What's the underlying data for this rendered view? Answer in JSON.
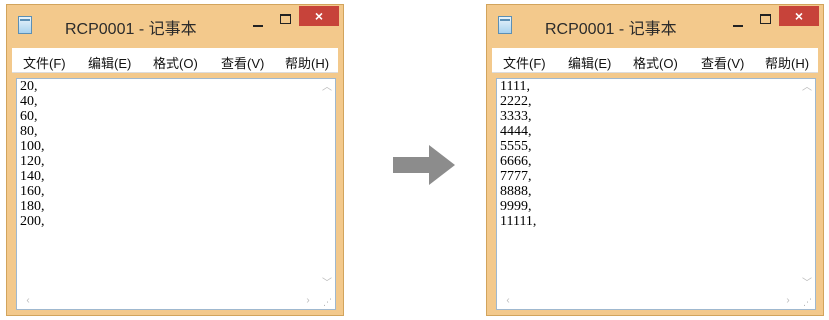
{
  "left_window": {
    "title": "RCP0001 - 记事本",
    "menu": [
      "文件(F)",
      "编辑(E)",
      "格式(O)",
      "查看(V)",
      "帮助(H)"
    ],
    "content": "20,\n40,\n60,\n80,\n100,\n120,\n140,\n160,\n180,\n200,"
  },
  "right_window": {
    "title": "RCP0001 - 记事本",
    "menu": [
      "文件(F)",
      "编辑(E)",
      "格式(O)",
      "查看(V)",
      "帮助(H)"
    ],
    "content": "1111,\n2222,\n3333,\n4444,\n5555,\n6666,\n7777,\n8888,\n9999,\n11111,"
  },
  "window_buttons": {
    "close_glyph": "×"
  },
  "colors": {
    "frame": "#f3c98c",
    "close": "#c7433a",
    "arrow": "#8c8c8c"
  }
}
